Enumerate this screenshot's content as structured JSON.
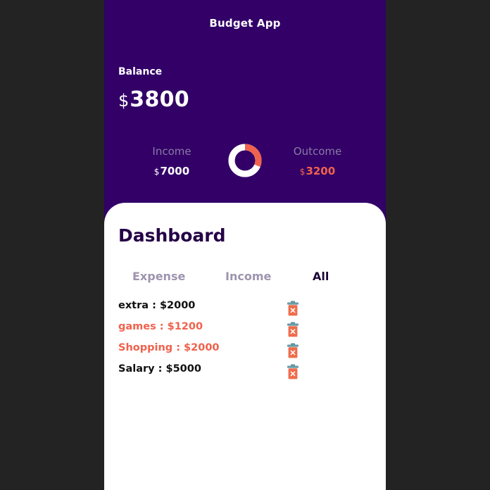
{
  "app": {
    "title": "Budget App"
  },
  "balance": {
    "label": "Balance",
    "currency": "$",
    "amount": "3800"
  },
  "income": {
    "label": "Income",
    "currency": "$",
    "amount": "7000"
  },
  "outcome": {
    "label": "Outcome",
    "currency": "$",
    "amount": "3200"
  },
  "donut_chart": {
    "income_value": 7000,
    "outcome_value": 3200,
    "colors": {
      "income": "#ffffff",
      "outcome": "#f0624d"
    }
  },
  "dashboard": {
    "title": "Dashboard",
    "tabs": [
      {
        "label": "Expense",
        "active": false
      },
      {
        "label": "Income",
        "active": false
      },
      {
        "label": "All",
        "active": true
      }
    ],
    "entries": [
      {
        "text": "extra : $2000",
        "type": "income"
      },
      {
        "text": "games : $1200",
        "type": "expense"
      },
      {
        "text": "Shopping : $2000",
        "type": "expense"
      },
      {
        "text": "Salary : $5000",
        "type": "income"
      }
    ]
  },
  "colors": {
    "header_background": "#320067",
    "page_background": "#232323",
    "accent_red": "#f0624d",
    "income_text": "#111111",
    "dark_text": "#240046"
  },
  "icons": {
    "delete": "trash-icon"
  }
}
